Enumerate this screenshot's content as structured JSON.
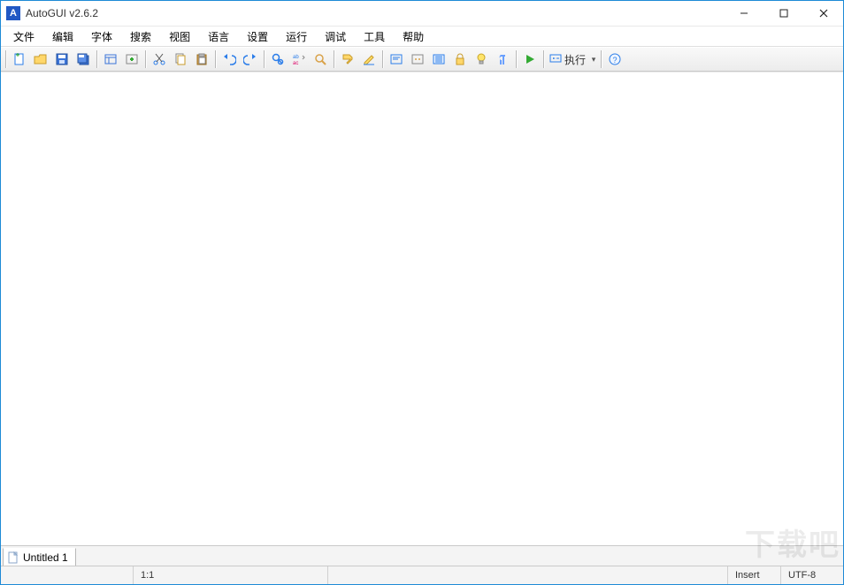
{
  "title": "AutoGUI v2.6.2",
  "menus": [
    "文件",
    "编辑",
    "字体",
    "搜索",
    "视图",
    "语言",
    "设置",
    "运行",
    "调试",
    "工具",
    "帮助"
  ],
  "toolbar": {
    "run_label": "执行",
    "run_dropdown": "▾"
  },
  "tab": {
    "label": "Untitled 1"
  },
  "status": {
    "position": "1:1",
    "insert_mode": "Insert",
    "encoding": "UTF-8"
  },
  "watermark": "下载吧"
}
